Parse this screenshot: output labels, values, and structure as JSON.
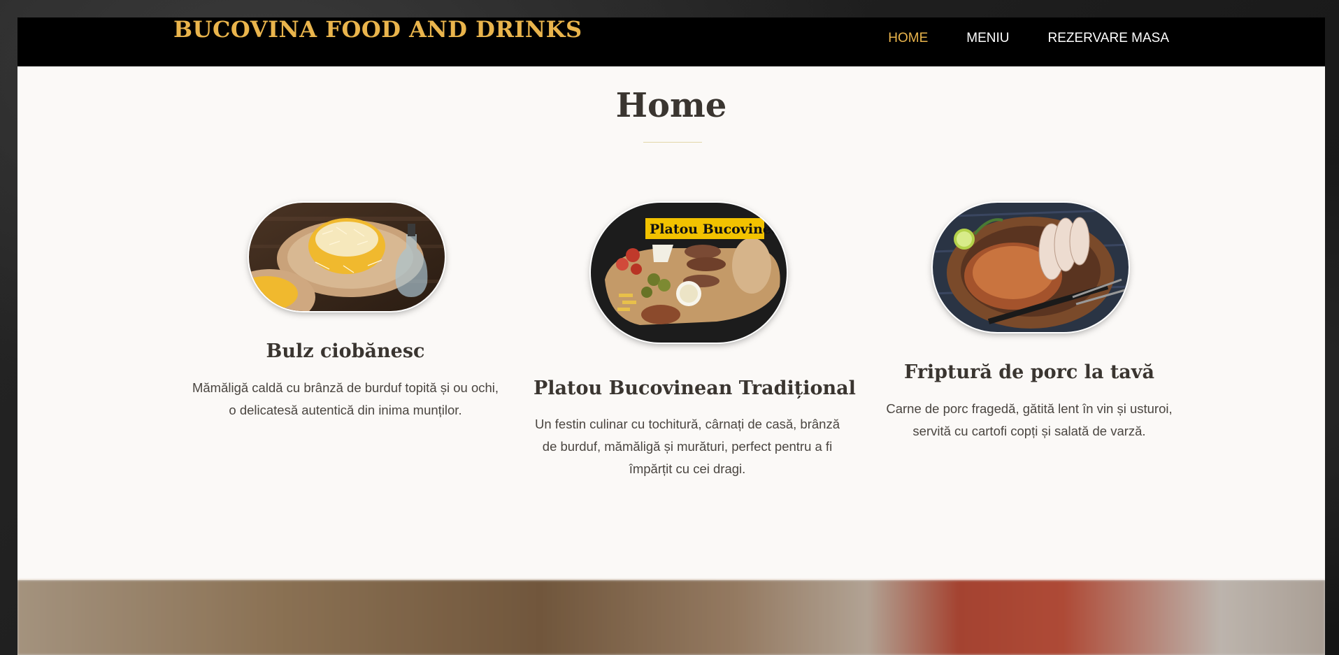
{
  "brand": {
    "name": "BUCOVINA FOOD AND DRINKS"
  },
  "nav": {
    "items": [
      {
        "label": "HOME"
      },
      {
        "label": "MENIU"
      },
      {
        "label": "REZERVARE MASA"
      }
    ]
  },
  "page": {
    "title": "Home"
  },
  "dishes": [
    {
      "name": "Bulz ciobănesc",
      "description": "Mămăligă caldă cu brânză de burduf topită și ou ochi, o delicatesă autentică din inima munților."
    },
    {
      "name": "Platou Bucovinean Tradițional",
      "description": "Un festin culinar cu tochitură, cârnați de casă, brânză de burduf, mămăligă și murături, perfect pentru a fi împărțit cu cei dragi.",
      "image_label": "Platou Bucovinea"
    },
    {
      "name": "Friptură de porc la tavă",
      "description": "Carne de porc fragedă, gătită lent în vin și usturoi, servită cu cartofi copți și salată de varză."
    }
  ],
  "colors": {
    "accent": "#e9b44c",
    "header_bg": "#000000",
    "content_bg": "#fbf9f7",
    "heading": "#3a3530"
  }
}
